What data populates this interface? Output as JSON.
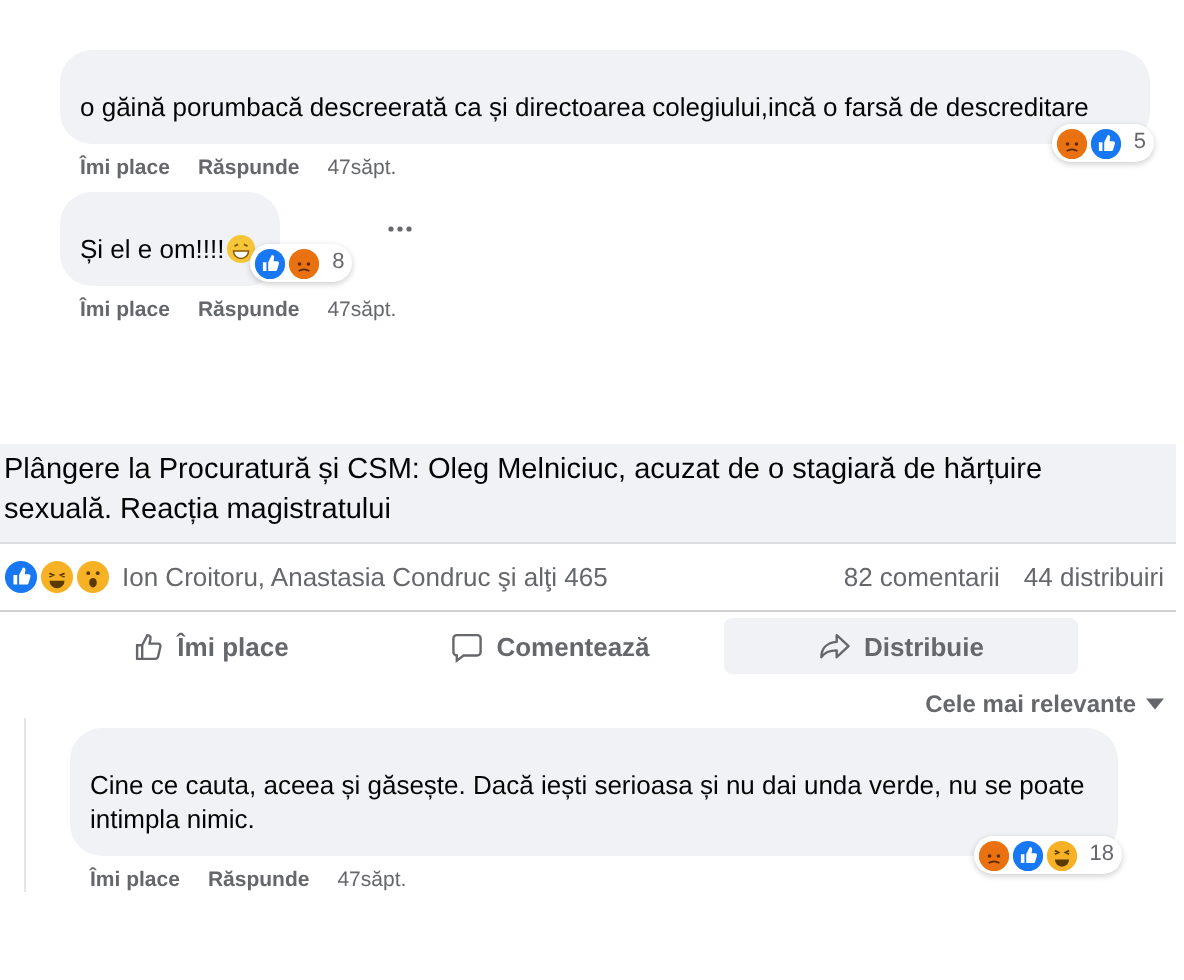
{
  "comments_top": [
    {
      "text": "o găină porumbacă descreerată ca și directoarea colegiului,incă o farsă de descreditare",
      "reactions": [
        {
          "kind": "angry"
        },
        {
          "kind": "like"
        }
      ],
      "reaction_count": "5",
      "more": false,
      "actions": [
        "Îmi place",
        "Răspunde",
        "47săpt."
      ]
    },
    {
      "text": "Și el e om!!!!",
      "emoji": {
        "kind": "grin"
      },
      "reactions": [
        {
          "kind": "like"
        },
        {
          "kind": "angry"
        }
      ],
      "reaction_count": "8",
      "more": true,
      "actions": [
        "Îmi place",
        "Răspunde",
        "47săpt."
      ]
    }
  ],
  "post": {
    "headline": "Plângere la Procuratură și CSM: Oleg Melniciuc, acuzat de o stagiară de hărțuire sexuală. Reacția magistratului",
    "reactions": [
      {
        "kind": "like"
      },
      {
        "kind": "haha"
      },
      {
        "kind": "wow"
      }
    ],
    "reactors": "Ion Croitoru, Anastasia Condruc şi alţi 465",
    "comments_count": "82 comentarii",
    "shares_count": "44 distribuiri",
    "buttons": [
      {
        "kind": "like",
        "label": "Îmi place",
        "selected": false
      },
      {
        "kind": "comment",
        "label": "Comentează",
        "selected": false
      },
      {
        "kind": "share",
        "label": "Distribuie",
        "selected": true
      }
    ],
    "sort": "Cele mai relevante"
  },
  "comments_bottom": [
    {
      "text": "Cine ce cauta, aceea și găsește. Dacă iești serioasa și nu dai unda verde, nu se poate intimpla nimic.",
      "reactions": [
        {
          "kind": "angry"
        },
        {
          "kind": "like"
        },
        {
          "kind": "haha"
        }
      ],
      "reaction_count": "18",
      "actions": [
        "Îmi place",
        "Răspunde",
        "47săpt."
      ]
    }
  ]
}
